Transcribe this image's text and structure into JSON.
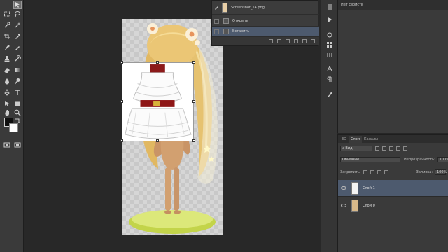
{
  "toolbar": {
    "tools": [
      "move",
      "artboard",
      "rect-marquee",
      "lasso",
      "quick-select",
      "magic-wand",
      "crop",
      "slice",
      "eyedropper",
      "ruler",
      "healing",
      "patch",
      "brush",
      "pencil",
      "stamp",
      "history-brush",
      "eraser",
      "bg-eraser",
      "gradient",
      "paint-bucket",
      "blur",
      "dodge",
      "pen",
      "text",
      "path-select",
      "shape",
      "hand",
      "zoom",
      "quick-mask",
      "screen-mode"
    ],
    "active_tool": "move"
  },
  "file_panel": {
    "filename": "Screenshot_14.png",
    "action_open": "Открыть",
    "action_insert": "Вставить"
  },
  "properties": {
    "title": "Нет свойств"
  },
  "layers": {
    "tabs": [
      "3D",
      "Слои",
      "Каналы"
    ],
    "active_tab": "Слои",
    "filter_kind": "Вид",
    "blend_mode": "Обычные",
    "opacity_label": "Непрозрачность:",
    "opacity_value": "100%",
    "lock_label": "Закрепить:",
    "fill_label": "Заливка:",
    "fill_value": "100%",
    "items": [
      {
        "name": "Слой 1",
        "selected": true
      },
      {
        "name": "Слой 0",
        "selected": false
      }
    ]
  },
  "colors": {
    "selection": "#4d5a6e",
    "foreground": "#101010",
    "background": "#ffffff"
  }
}
